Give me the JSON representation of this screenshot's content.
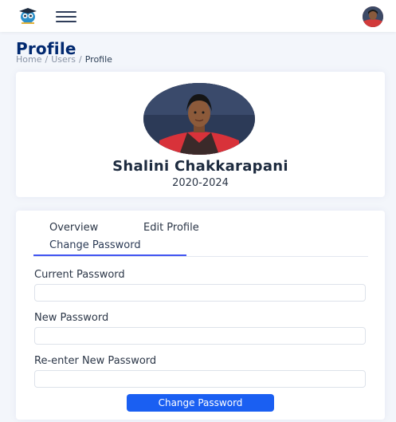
{
  "header": {
    "logo_icon": "graduation-owl-logo-icon",
    "menu_icon": "hamburger-menu-icon",
    "avatar_icon": "user-avatar-icon"
  },
  "page": {
    "title": "Profile",
    "breadcrumb": [
      "Home",
      "Users",
      "Profile"
    ],
    "breadcrumb_separator": "/"
  },
  "profile": {
    "name": "Shalini Chakkarapani",
    "years": "2020-2024"
  },
  "tabs": {
    "overview": "Overview",
    "edit_profile": "Edit Profile",
    "change_password": "Change Password",
    "active": "Change Password"
  },
  "form": {
    "current_password_label": "Current Password",
    "current_password_value": "",
    "new_password_label": "New Password",
    "new_password_value": "",
    "reenter_password_label": "Re-enter New Password",
    "reenter_password_value": "",
    "submit_label": "Change Password"
  },
  "colors": {
    "accent": "#4154f1",
    "button": "#1a5ff2",
    "title": "#012970",
    "background": "#f3f6fb"
  }
}
